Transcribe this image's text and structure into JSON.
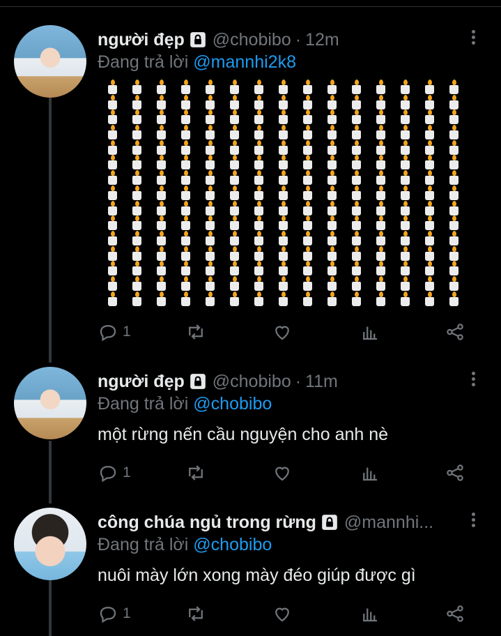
{
  "tweets": [
    {
      "name": "người đẹp",
      "handle": "@chobibo",
      "separator": "·",
      "time": "12m",
      "reply_prefix": "Đang trả lời",
      "reply_to": "@mannhi2k8",
      "text": "",
      "candle_count": 225,
      "reply_count": "1"
    },
    {
      "name": "người đẹp",
      "handle": "@chobibo",
      "separator": "·",
      "time": "11m",
      "reply_prefix": "Đang trả lời",
      "reply_to": "@chobibo",
      "text": "một rừng nến cầu nguyện cho anh nè",
      "reply_count": "1"
    },
    {
      "name": "công chúa ngủ trong rừng",
      "handle": "@mannhi...",
      "reply_prefix": "Đang trả lời",
      "reply_to": "@chobibo",
      "text": "nuôi mày lớn xong mày đéo giúp được gì",
      "reply_count": "1"
    }
  ],
  "icons": [
    "lock-icon",
    "more-icon",
    "reply-icon",
    "retweet-icon",
    "like-icon",
    "analytics-icon",
    "share-icon"
  ],
  "colors": {
    "background": "#000000",
    "text": "#e7e9ea",
    "muted": "#71767b",
    "link": "#1d9bf0"
  }
}
